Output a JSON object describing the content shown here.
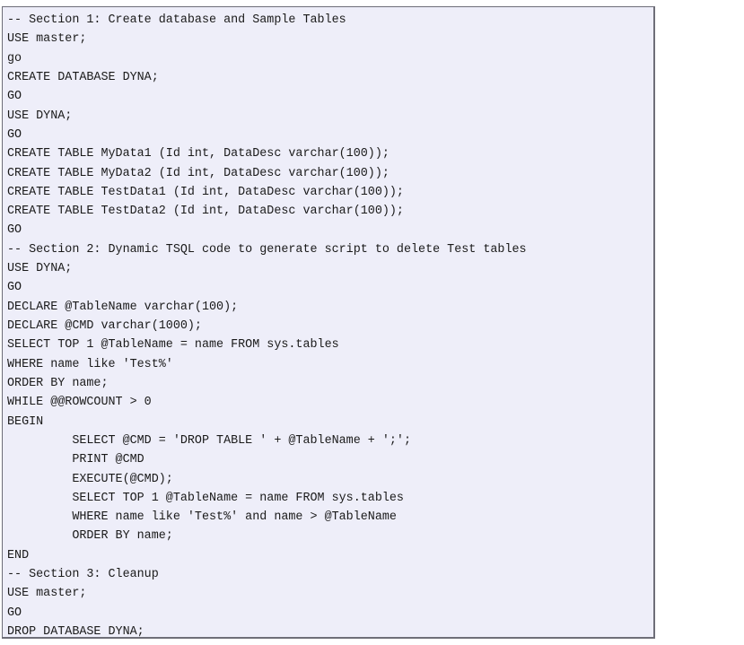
{
  "document": {
    "type": "code-block",
    "language": "tsql",
    "background_color": "#eeeef9",
    "border_color": "#6e6e78",
    "text_color": "#1a1a1a"
  },
  "code": {
    "full_text": "-- Section 1: Create database and Sample Tables\nUSE master;\ngo\nCREATE DATABASE DYNA;\nGO\nUSE DYNA;\nGO\nCREATE TABLE MyData1 (Id int, DataDesc varchar(100));\nCREATE TABLE MyData2 (Id int, DataDesc varchar(100));\nCREATE TABLE TestData1 (Id int, DataDesc varchar(100));\nCREATE TABLE TestData2 (Id int, DataDesc varchar(100));\nGO\n-- Section 2: Dynamic TSQL code to generate script to delete Test tables\nUSE DYNA;\nGO\nDECLARE @TableName varchar(100);\nDECLARE @CMD varchar(1000);\nSELECT TOP 1 @TableName = name FROM sys.tables\nWHERE name like 'Test%'\nORDER BY name;\nWHILE @@ROWCOUNT > 0\nBEGIN\n         SELECT @CMD = 'DROP TABLE ' + @TableName + ';';\n         PRINT @CMD\n         EXECUTE(@CMD);\n         SELECT TOP 1 @TableName = name FROM sys.tables\n         WHERE name like 'Test%' and name > @TableName\n         ORDER BY name;\nEND\n-- Section 3: Cleanup\nUSE master;\nGO\nDROP DATABASE DYNA;",
    "lines": [
      "-- Section 1: Create database and Sample Tables",
      "USE master;",
      "go",
      "CREATE DATABASE DYNA;",
      "GO",
      "USE DYNA;",
      "GO",
      "CREATE TABLE MyData1 (Id int, DataDesc varchar(100));",
      "CREATE TABLE MyData2 (Id int, DataDesc varchar(100));",
      "CREATE TABLE TestData1 (Id int, DataDesc varchar(100));",
      "CREATE TABLE TestData2 (Id int, DataDesc varchar(100));",
      "GO",
      "-- Section 2: Dynamic TSQL code to generate script to delete Test tables",
      "USE DYNA;",
      "GO",
      "DECLARE @TableName varchar(100);",
      "DECLARE @CMD varchar(1000);",
      "SELECT TOP 1 @TableName = name FROM sys.tables",
      "WHERE name like 'Test%'",
      "ORDER BY name;",
      "WHILE @@ROWCOUNT > 0",
      "BEGIN",
      "         SELECT @CMD = 'DROP TABLE ' + @TableName + ';';",
      "         PRINT @CMD",
      "         EXECUTE(@CMD);",
      "         SELECT TOP 1 @TableName = name FROM sys.tables",
      "         WHERE name like 'Test%' and name > @TableName",
      "         ORDER BY name;",
      "END",
      "-- Section 3: Cleanup",
      "USE master;",
      "GO",
      "DROP DATABASE DYNA;"
    ]
  }
}
